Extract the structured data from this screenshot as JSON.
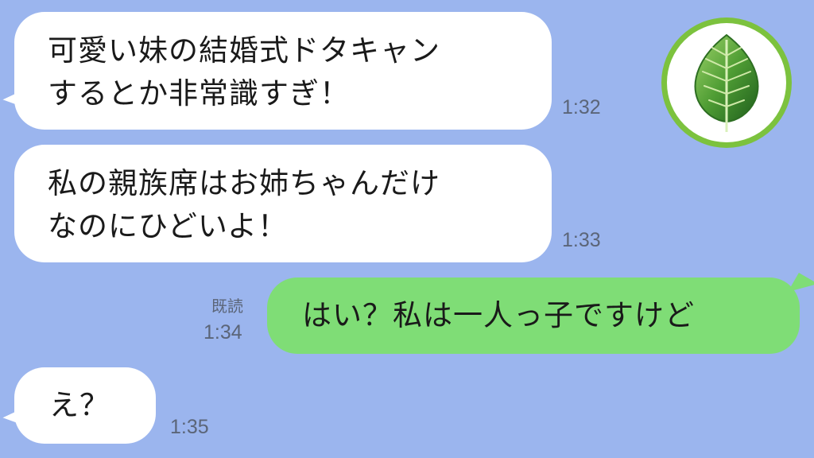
{
  "chat": {
    "messages": [
      {
        "side": "received",
        "lines": [
          "可愛い妹の結婚式ドタキャン",
          "するとか非常識すぎ！"
        ],
        "time": "1:32"
      },
      {
        "side": "received",
        "lines": [
          "私の親族席はお姉ちゃんだけ",
          "なのにひどいよ！"
        ],
        "time": "1:33"
      },
      {
        "side": "sent",
        "text": "はい？私は一人っ子ですけど",
        "read_label": "既読",
        "time": "1:34"
      },
      {
        "side": "received",
        "text": "え？",
        "time": "1:35"
      }
    ]
  },
  "avatar": {
    "icon": "leaf-icon",
    "ring_color": "#7cc23e"
  },
  "colors": {
    "background": "#9bb5ee",
    "received_bubble": "#ffffff",
    "sent_bubble": "#7fdd76"
  }
}
